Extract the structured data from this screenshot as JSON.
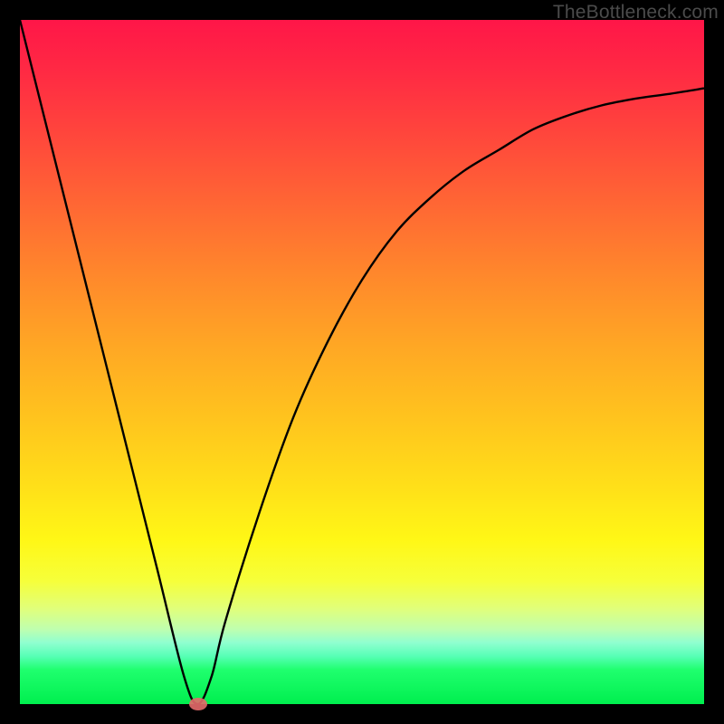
{
  "watermark": "TheBottleneck.com",
  "colors": {
    "page_bg": "#000000",
    "curve_stroke": "#000000",
    "marker_fill": "#e46a6a",
    "gradient_top": "#ff1648",
    "gradient_bottom": "#00ef4e"
  },
  "chart_data": {
    "type": "line",
    "title": "",
    "xlabel": "",
    "ylabel": "",
    "xlim": [
      0,
      100
    ],
    "ylim": [
      0,
      100
    ],
    "grid": false,
    "legend": false,
    "annotations": [
      "TheBottleneck.com"
    ],
    "series": [
      {
        "name": "bottleneck-curve",
        "x": [
          0,
          5,
          10,
          15,
          20,
          24,
          26,
          28,
          30,
          35,
          40,
          45,
          50,
          55,
          60,
          65,
          70,
          75,
          80,
          85,
          90,
          95,
          100
        ],
        "y": [
          100,
          80,
          60,
          40,
          20,
          4,
          0,
          4,
          12,
          28,
          42,
          53,
          62,
          69,
          74,
          78,
          81,
          84,
          86,
          87.5,
          88.5,
          89.2,
          90
        ]
      }
    ],
    "markers": [
      {
        "name": "min-point",
        "x": 26,
        "y": 0
      }
    ]
  }
}
